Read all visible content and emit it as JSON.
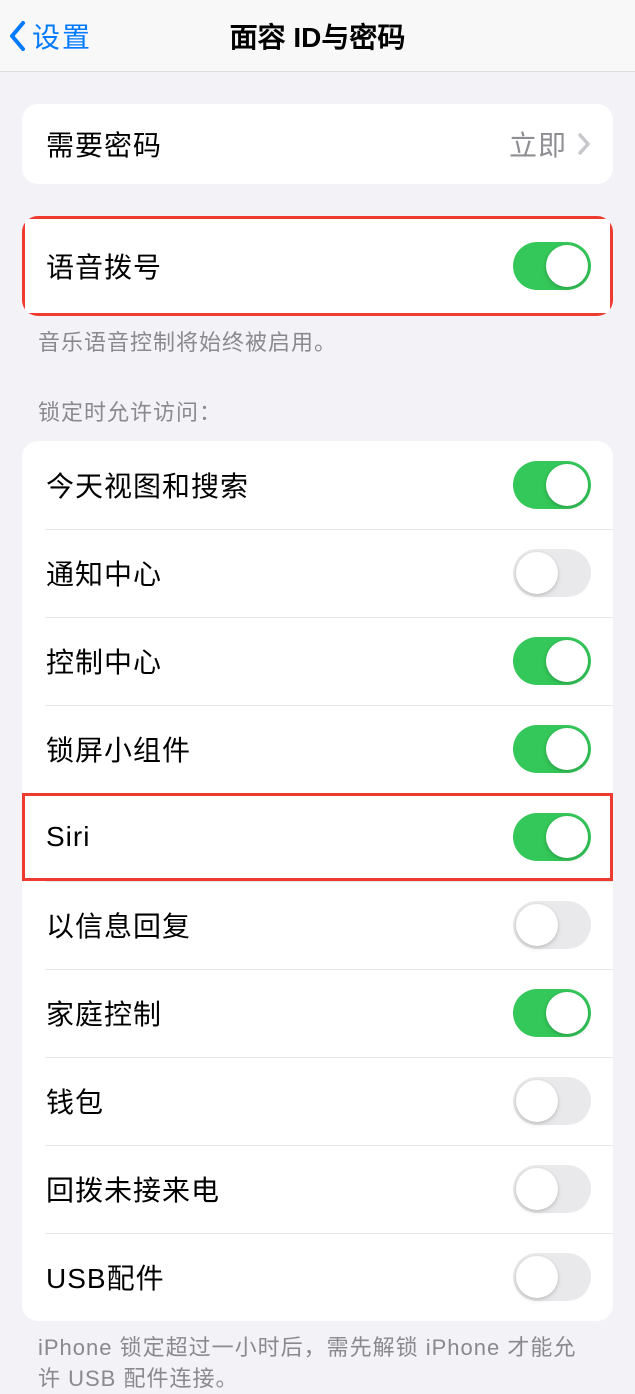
{
  "header": {
    "back_label": "设置",
    "title": "面容 ID与密码"
  },
  "require_passcode": {
    "label": "需要密码",
    "value": "立即"
  },
  "voice_dial": {
    "label": "语音拨号",
    "enabled": true,
    "footer": "音乐语音控制将始终被启用。"
  },
  "lock_access": {
    "header": "锁定时允许访问：",
    "items": [
      {
        "label": "今天视图和搜索",
        "enabled": true
      },
      {
        "label": "通知中心",
        "enabled": false
      },
      {
        "label": "控制中心",
        "enabled": true
      },
      {
        "label": "锁屏小组件",
        "enabled": true
      },
      {
        "label": "Siri",
        "enabled": true
      },
      {
        "label": "以信息回复",
        "enabled": false
      },
      {
        "label": "家庭控制",
        "enabled": true
      },
      {
        "label": "钱包",
        "enabled": false
      },
      {
        "label": "回拨未接来电",
        "enabled": false
      },
      {
        "label": "USB配件",
        "enabled": false
      }
    ],
    "footer": "iPhone 锁定超过一小时后，需先解锁 iPhone 才能允许 USB 配件连接。"
  }
}
